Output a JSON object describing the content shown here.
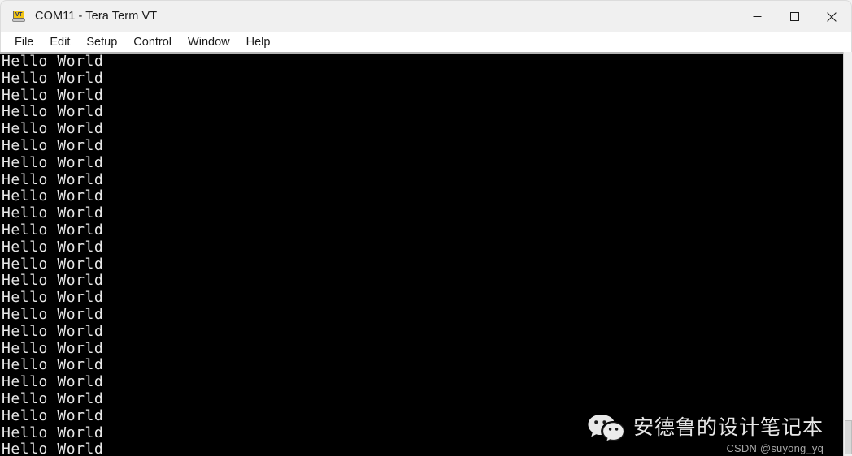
{
  "window": {
    "title": "COM11 - Tera Term VT",
    "icon_name": "tera-term-vt-icon",
    "icon_label": "VT",
    "controls": {
      "minimize_label": "Minimize",
      "maximize_label": "Maximize",
      "close_label": "Close"
    }
  },
  "menu": {
    "items": [
      {
        "label": "File"
      },
      {
        "label": "Edit"
      },
      {
        "label": "Setup"
      },
      {
        "label": "Control"
      },
      {
        "label": "Window"
      },
      {
        "label": "Help"
      }
    ]
  },
  "terminal": {
    "background_color": "#000000",
    "text_color": "#e8e8e8",
    "repeated_line": "Hello World",
    "line_count": 24,
    "output": "Hello World\nHello World\nHello World\nHello World\nHello World\nHello World\nHello World\nHello World\nHello World\nHello World\nHello World\nHello World\nHello World\nHello World\nHello World\nHello World\nHello World\nHello World\nHello World\nHello World\nHello World\nHello World\nHello World\nHello World"
  },
  "watermark": {
    "icon_name": "wechat-icon",
    "title": "安德鲁的设计笔记本",
    "subtitle": "CSDN @suyong_yq"
  },
  "colors": {
    "titlebar": "#f0f0f0",
    "menubar": "#ffffff",
    "terminal_bg": "#000000",
    "icon_accent": "#f2c513"
  }
}
